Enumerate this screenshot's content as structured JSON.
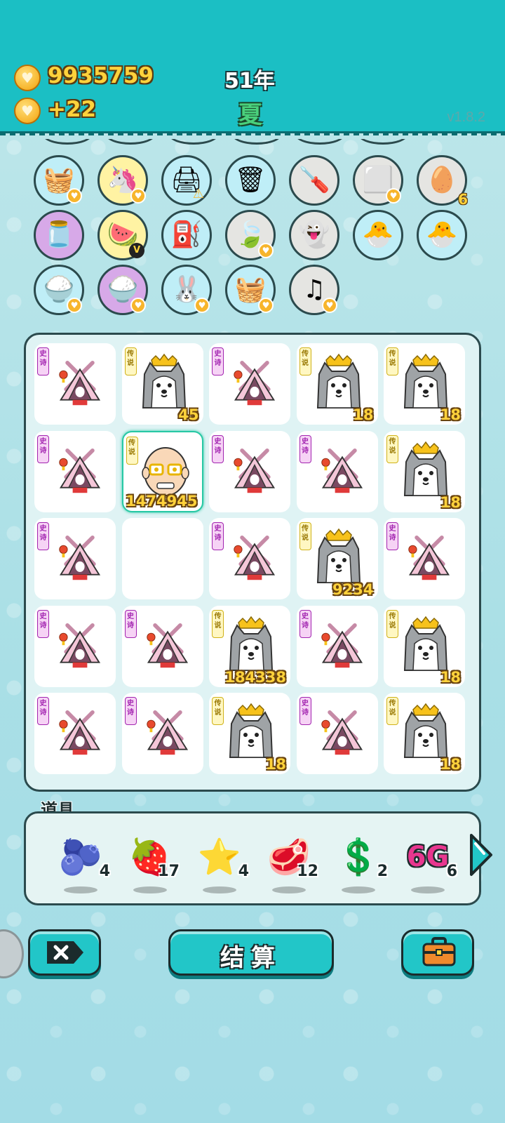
{
  "header": {
    "coins": "9935759",
    "income": "+22",
    "year": "51年",
    "season": "夏",
    "version": "v1.8.2"
  },
  "inventory_circles": [
    {
      "icon": "fruit-basket-icon",
      "glyph": "🧺",
      "bg": "blue",
      "heart": true
    },
    {
      "icon": "unicorn-icon",
      "glyph": "🦄",
      "bg": "yellow",
      "heart": true
    },
    {
      "icon": "printer-icon",
      "glyph": "🖨",
      "bg": "blue",
      "warn": true
    },
    {
      "icon": "garbage-bag-icon",
      "glyph": "🗑",
      "bg": "blue"
    },
    {
      "icon": "screwdriver-icon",
      "glyph": "🪛",
      "bg": "gray"
    },
    {
      "icon": "sugar-cubes-icon",
      "glyph": "⬜",
      "bg": "gray",
      "heart": true
    },
    {
      "icon": "egg-tray-icon",
      "glyph": "🥚",
      "bg": "gray",
      "count": "6"
    },
    {
      "icon": "jar-icon",
      "glyph": "🫙",
      "bg": "purple"
    },
    {
      "icon": "fruit-platter-icon",
      "glyph": "🍉",
      "bg": "yellow",
      "vbadge": "V"
    },
    {
      "icon": "bike-pump-icon",
      "glyph": "⛽",
      "bg": "blue"
    },
    {
      "icon": "leaf-icon",
      "glyph": "🍃",
      "bg": "gray",
      "heart": true
    },
    {
      "icon": "ghost-icon",
      "glyph": "👻",
      "bg": "gray"
    },
    {
      "icon": "chick-egg-icon",
      "glyph": "🐣",
      "bg": "blue"
    },
    {
      "icon": "chick-egg-icon",
      "glyph": "🐣",
      "bg": "blue"
    },
    {
      "icon": "rice-bowl-icon",
      "glyph": "🍚",
      "bg": "blue",
      "heart": true
    },
    {
      "icon": "rice-bowl-icon",
      "glyph": "🍚",
      "bg": "purple",
      "heart": true
    },
    {
      "icon": "rabbit-icon",
      "glyph": "🐰",
      "bg": "blue",
      "heart": true
    },
    {
      "icon": "fruit-basket-icon",
      "glyph": "🧺",
      "bg": "blue",
      "heart": true
    },
    {
      "icon": "music-note-icon",
      "glyph": "♫",
      "bg": "gray",
      "heart": true
    }
  ],
  "board": {
    "rows": [
      [
        {
          "type": "tent",
          "rarity": "epic",
          "tag": "史诗",
          "count": ""
        },
        {
          "type": "husky",
          "rarity": "legend",
          "tag": "传说",
          "count": "45"
        },
        {
          "type": "tent",
          "rarity": "epic",
          "tag": "史诗",
          "count": ""
        },
        {
          "type": "husky",
          "rarity": "legend",
          "tag": "传说",
          "count": "18"
        },
        {
          "type": "husky",
          "rarity": "legend",
          "tag": "传说",
          "count": "18"
        }
      ],
      [
        {
          "type": "tent",
          "rarity": "epic",
          "tag": "史诗",
          "count": ""
        },
        {
          "type": "oldman",
          "rarity": "legend",
          "tag": "传说",
          "count": "1474945",
          "selected": true
        },
        {
          "type": "tent",
          "rarity": "epic",
          "tag": "史诗",
          "count": ""
        },
        {
          "type": "tent",
          "rarity": "epic",
          "tag": "史诗",
          "count": ""
        },
        {
          "type": "husky",
          "rarity": "legend",
          "tag": "传说",
          "count": "18"
        }
      ],
      [
        {
          "type": "tent",
          "rarity": "epic",
          "tag": "史诗",
          "count": ""
        },
        {
          "type": "empty"
        },
        {
          "type": "tent",
          "rarity": "epic",
          "tag": "史诗",
          "count": ""
        },
        {
          "type": "husky",
          "rarity": "legend",
          "tag": "传说",
          "count": "9234"
        },
        {
          "type": "tent",
          "rarity": "epic",
          "tag": "史诗",
          "count": ""
        }
      ],
      [
        {
          "type": "tent",
          "rarity": "epic",
          "tag": "史诗",
          "count": ""
        },
        {
          "type": "tent",
          "rarity": "epic",
          "tag": "史诗",
          "count": ""
        },
        {
          "type": "husky",
          "rarity": "legend",
          "tag": "传说",
          "count": "184338"
        },
        {
          "type": "tent",
          "rarity": "epic",
          "tag": "史诗",
          "count": ""
        },
        {
          "type": "husky",
          "rarity": "legend",
          "tag": "传说",
          "count": "18"
        }
      ],
      [
        {
          "type": "tent",
          "rarity": "epic",
          "tag": "史诗",
          "count": ""
        },
        {
          "type": "tent",
          "rarity": "epic",
          "tag": "史诗",
          "count": ""
        },
        {
          "type": "husky",
          "rarity": "legend",
          "tag": "传说",
          "count": "18"
        },
        {
          "type": "tent",
          "rarity": "epic",
          "tag": "史诗",
          "count": ""
        },
        {
          "type": "husky",
          "rarity": "legend",
          "tag": "传说",
          "count": "18"
        }
      ]
    ]
  },
  "props": {
    "title": "道具",
    "items": [
      {
        "icon": "blueberry-icon",
        "glyph": "🫐",
        "count": "4"
      },
      {
        "icon": "lychee-icon",
        "glyph": "🍓",
        "count": "17"
      },
      {
        "icon": "star-icon",
        "glyph": "⭐",
        "count": "4"
      },
      {
        "icon": "liver-icon",
        "glyph": "🥩",
        "count": "12"
      },
      {
        "icon": "dollar-coin-icon",
        "glyph": "💲",
        "count": "2"
      },
      {
        "icon": "6g-icon",
        "glyph": "6G",
        "count": "6"
      }
    ]
  },
  "buttons": {
    "settle_label": "结算"
  },
  "colors": {
    "header": "#1bbfc4",
    "gold": "#ffd23b",
    "epic": "#a224b0",
    "legend": "#d0b218",
    "button": "#22c6c8"
  }
}
